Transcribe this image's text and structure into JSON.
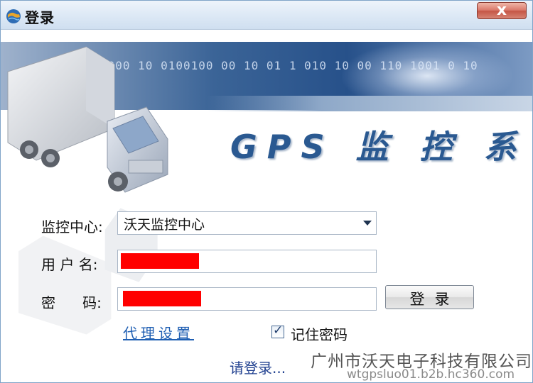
{
  "window": {
    "title": "登录",
    "close_label": "x"
  },
  "banner": {
    "digits": "0000 10 0100100 00 10 01 1 010 10 00 110 1001 0 10",
    "brand": "GPS 监 控 系 统"
  },
  "form": {
    "center_label": "监控中心:",
    "center_value": "沃天监控中心",
    "user_label": "用 户 名:",
    "user_value": "",
    "password_label": "密      码:",
    "password_value": "",
    "login_button": "登录",
    "proxy_link": "代理设置",
    "remember_checked": true,
    "remember_label": "记住密码",
    "status": "请登录..."
  },
  "overlay": {
    "company": "广州市沃天电子科技有限公司",
    "url": "wtgpsluo01.b2b.hc360.com"
  },
  "colors": {
    "brand": "#2a5991",
    "link": "#1f5fb3",
    "redaction": "#ff0000"
  },
  "icons": {
    "app": "globe-icon",
    "close": "close-icon",
    "dropdown": "chevron-down-icon",
    "check": "check-icon"
  }
}
